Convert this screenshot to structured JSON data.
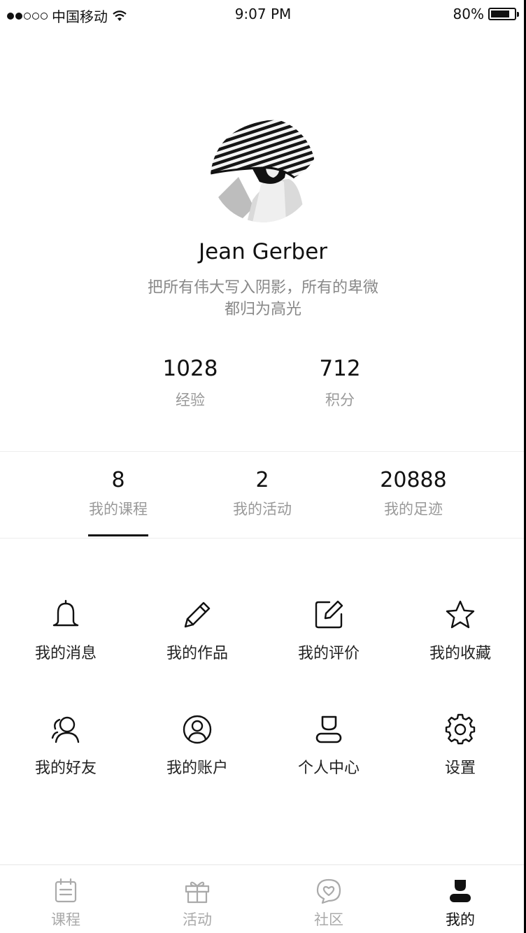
{
  "status_bar": {
    "carrier": "中国移动",
    "time": "9:07 PM",
    "battery": "80%",
    "battery_level": 0.8,
    "signal_bars": 2,
    "signal_total": 5,
    "icons": [
      "signal-dots-icon",
      "wifi-icon",
      "battery-icon"
    ]
  },
  "profile": {
    "name": "Jean Gerber",
    "bio_line1": "把所有伟大写入阴影，所有的卑微",
    "bio_line2": "都归为高光",
    "avatar_icon": "avatar-photo-icon"
  },
  "stats": [
    {
      "value": "1028",
      "label": "经验"
    },
    {
      "value": "712",
      "label": "积分"
    }
  ],
  "tabs": [
    {
      "value": "8",
      "label": "我的课程",
      "active": true
    },
    {
      "value": "2",
      "label": "我的活动",
      "active": false
    },
    {
      "value": "20888",
      "label": "我的足迹",
      "active": false
    }
  ],
  "grid": [
    {
      "label": "我的消息",
      "icon": "bell-icon"
    },
    {
      "label": "我的作品",
      "icon": "pencil-icon"
    },
    {
      "label": "我的评价",
      "icon": "edit-icon"
    },
    {
      "label": "我的收藏",
      "icon": "star-icon"
    },
    {
      "label": "我的好友",
      "icon": "friends-icon"
    },
    {
      "label": "我的账户",
      "icon": "account-icon"
    },
    {
      "label": "个人中心",
      "icon": "person-icon"
    },
    {
      "label": "设置",
      "icon": "gear-icon"
    }
  ],
  "bottom_nav": [
    {
      "label": "课程",
      "icon": "calendar-icon",
      "active": false
    },
    {
      "label": "活动",
      "icon": "gift-icon",
      "active": false
    },
    {
      "label": "社区",
      "icon": "heart-bubble-icon",
      "active": false
    },
    {
      "label": "我的",
      "icon": "user-filled-icon",
      "active": true
    }
  ],
  "colors": {
    "text_primary": "#111111",
    "text_secondary": "#999999",
    "bio": "#888888",
    "nav_inactive": "#aaaaaa",
    "divider": "#eeeeee"
  }
}
